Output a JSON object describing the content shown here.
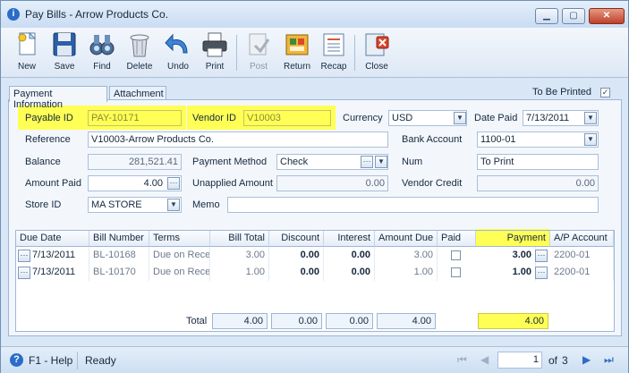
{
  "window": {
    "title": "Pay Bills - Arrow Products Co."
  },
  "toolbar": {
    "new": "New",
    "save": "Save",
    "find": "Find",
    "delete": "Delete",
    "undo": "Undo",
    "print": "Print",
    "post": "Post",
    "return": "Return",
    "recap": "Recap",
    "close": "Close"
  },
  "tabs": {
    "payment_info": "Payment Information",
    "attachment": "Attachment"
  },
  "to_be_printed": {
    "label": "To Be Printed",
    "checked": true
  },
  "form": {
    "payable_id_label": "Payable ID",
    "payable_id": "PAY-10171",
    "vendor_id_label": "Vendor ID",
    "vendor_id": "V10003",
    "currency_label": "Currency",
    "currency": "USD",
    "date_paid_label": "Date Paid",
    "date_paid": "7/13/2011",
    "reference_label": "Reference",
    "reference": "V10003-Arrow Products Co.",
    "bank_account_label": "Bank Account",
    "bank_account": "1100-01",
    "balance_label": "Balance",
    "balance": "281,521.41",
    "payment_method_label": "Payment Method",
    "payment_method": "Check",
    "num_label": "Num",
    "num": "To Print",
    "amount_paid_label": "Amount Paid",
    "amount_paid": "4.00",
    "unapplied_label": "Unapplied Amount",
    "unapplied": "0.00",
    "vendor_credit_label": "Vendor Credit",
    "vendor_credit": "0.00",
    "store_id_label": "Store ID",
    "store_id": "MA STORE",
    "memo_label": "Memo",
    "memo": ""
  },
  "grid": {
    "headers": [
      "Due Date",
      "Bill Number",
      "Terms",
      "Bill Total",
      "Discount",
      "Interest",
      "Amount Due",
      "Paid",
      "Payment",
      "A/P Account"
    ],
    "rows": [
      {
        "due_date": "7/13/2011",
        "bill_number": "BL-10168",
        "terms": "Due on Rece",
        "bill_total": "3.00",
        "discount": "0.00",
        "interest": "0.00",
        "amount_due": "3.00",
        "paid": false,
        "payment": "3.00",
        "ap_account": "2200-01"
      },
      {
        "due_date": "7/13/2011",
        "bill_number": "BL-10170",
        "terms": "Due on Rece",
        "bill_total": "1.00",
        "discount": "0.00",
        "interest": "0.00",
        "amount_due": "1.00",
        "paid": false,
        "payment": "1.00",
        "ap_account": "2200-01"
      }
    ],
    "totals": {
      "label": "Total",
      "bill_total": "4.00",
      "discount": "0.00",
      "interest": "0.00",
      "amount_due": "4.00",
      "payment": "4.00"
    }
  },
  "status": {
    "help": "F1 - Help",
    "text": "Ready",
    "page": "1",
    "of_label": "of",
    "page_count": "3"
  },
  "colors": {
    "highlight": "#ffff55",
    "accent": "#2a6dc8"
  }
}
